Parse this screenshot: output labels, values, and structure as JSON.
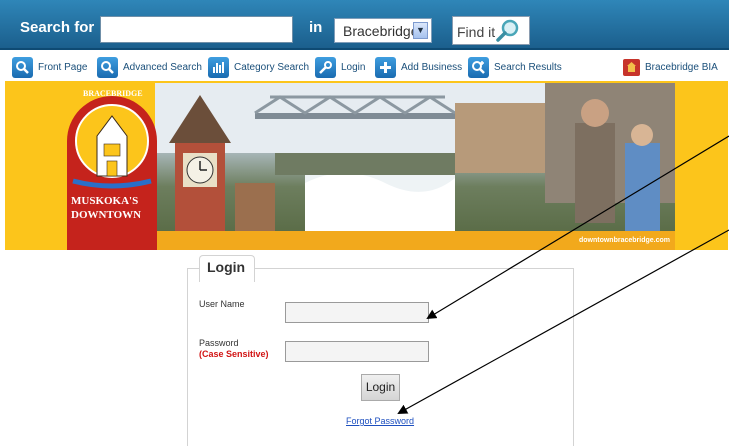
{
  "search": {
    "label": "Search for",
    "in_label": "in",
    "query_value": "",
    "location_value": "Bracebridge",
    "find_button": "Find it"
  },
  "nav": {
    "items": [
      {
        "label": "Front Page",
        "icon": "search-icon"
      },
      {
        "label": "Advanced Search",
        "icon": "search-icon"
      },
      {
        "label": "Category Search",
        "icon": "bar-chart-icon"
      },
      {
        "label": "Login",
        "icon": "key-icon"
      },
      {
        "label": "Add Business",
        "icon": "plus-icon"
      },
      {
        "label": "Search Results",
        "icon": "search-plus-icon"
      },
      {
        "label": "Bracebridge BIA",
        "icon": "bia-logo-icon"
      }
    ]
  },
  "banner": {
    "crest_top": "BRACEBRIDGE",
    "crest_line1": "MUSKOKA'S",
    "crest_line2": "DOWNTOWN",
    "url": "downtownbracebridge.com"
  },
  "login": {
    "tab_title": "Login",
    "username_label": "User Name",
    "username_value": "",
    "password_label": "Password",
    "case_note": "(Case Sensitive)",
    "password_value": "",
    "login_button": "Login",
    "forgot_link": "Forgot Password"
  },
  "colors": {
    "header_blue": "#2f86b8",
    "banner_yellow": "#fcc51b",
    "link_blue": "#1d4fbf",
    "case_red": "#d21414"
  }
}
